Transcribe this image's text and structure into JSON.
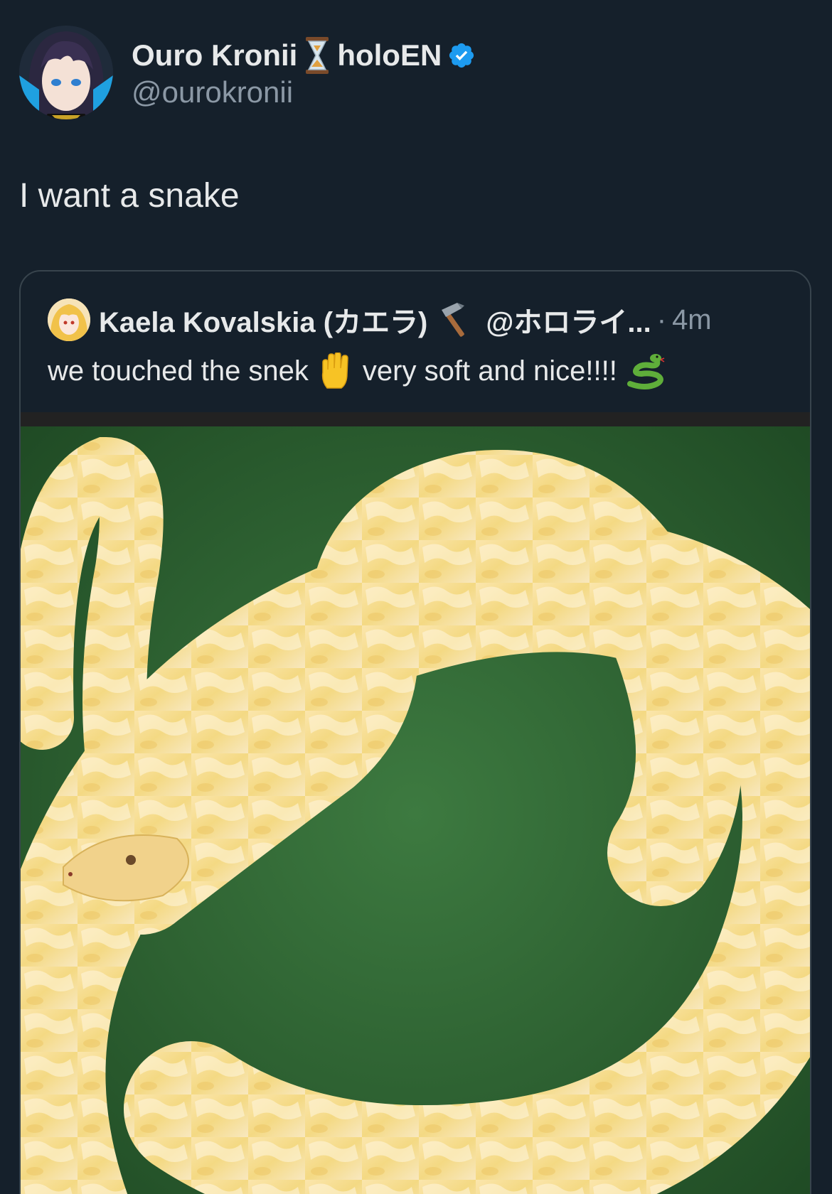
{
  "author": {
    "display_name": "Ouro Kronii",
    "name_suffix": "holoEN",
    "handle": "@ourokronii",
    "name_emoji": "hourglass-icon",
    "verified": true,
    "verified_color": "#1d9bf0"
  },
  "tweet": {
    "text": "I want a snake"
  },
  "quote": {
    "display_name": "Kaela Kovalskia (カエラ)",
    "name_emoji": "hammer-icon",
    "handle": "@ホロライ...",
    "separator": "·",
    "time": "4m",
    "text_part1": "we touched the snek",
    "text_emoji1": "raised-hand-icon",
    "text_part2": "very soft and nice!!!!",
    "text_emoji2": "snake-icon"
  },
  "colors": {
    "background": "#15202b",
    "text_primary": "#e7e9ea",
    "text_secondary": "#8b98a5",
    "border": "#38444d"
  }
}
